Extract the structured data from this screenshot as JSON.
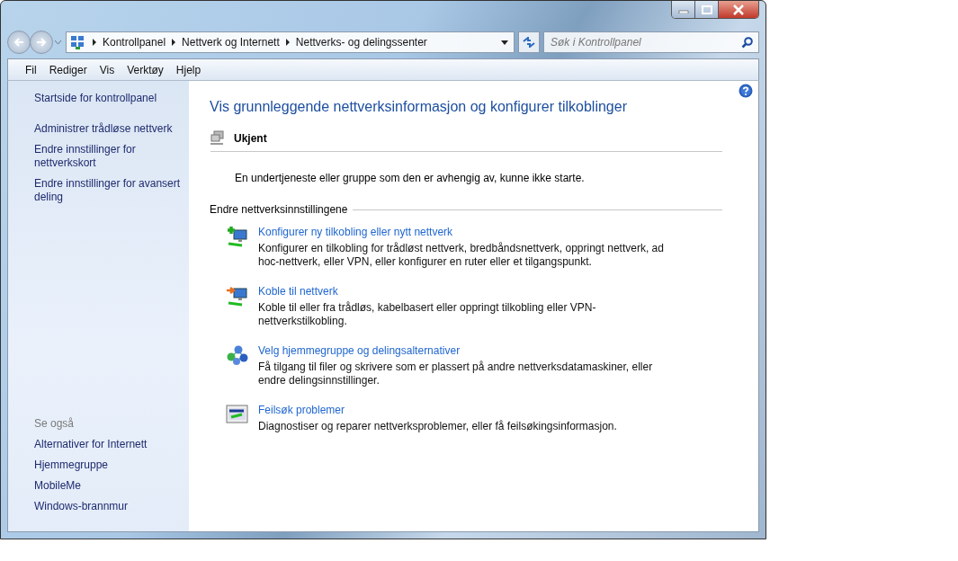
{
  "address_bar": {
    "breadcrumbs": [
      "Kontrollpanel",
      "Nettverk og Internett",
      "Nettverks- og delingssenter"
    ]
  },
  "search": {
    "placeholder": "Søk i Kontrollpanel"
  },
  "menu": [
    "Fil",
    "Rediger",
    "Vis",
    "Verktøy",
    "Hjelp"
  ],
  "sidebar": {
    "links": [
      "Startside for kontrollpanel",
      "Administrer trådløse nettverk",
      "Endre innstillinger for nettverkskort",
      "Endre innstillinger for avansert deling"
    ],
    "see_also_heading": "Se også",
    "see_also": [
      "Alternativer for Internett",
      "Hjemmegruppe",
      "MobileMe",
      "Windows-brannmur"
    ]
  },
  "main": {
    "title": "Vis grunnleggende nettverksinformasjon og konfigurer tilkoblinger",
    "network_name": "Ukjent",
    "status_message": "En undertjeneste eller gruppe som den er avhengig av, kunne ikke starte.",
    "section_heading": "Endre nettverksinnstillingene",
    "tasks": [
      {
        "title": "Konfigurer ny tilkobling eller nytt nettverk",
        "description": "Konfigurer en tilkobling for trådløst nettverk, bredbåndsnettverk, oppringt nettverk, ad hoc-nettverk, eller VPN, eller konfigurer en ruter eller et tilgangspunkt."
      },
      {
        "title": "Koble til nettverk",
        "description": "Koble til eller fra trådløs, kabelbasert eller oppringt tilkobling eller VPN-nettverkstilkobling."
      },
      {
        "title": "Velg hjemmegruppe og delingsalternativer",
        "description": "Få tilgang til filer og skrivere som er plassert på andre nettverksdatamaskiner, eller endre delingsinnstillinger."
      },
      {
        "title": "Feilsøk problemer",
        "description": "Diagnostiser og reparer nettverksproblemer, eller få feilsøkingsinformasjon."
      }
    ]
  }
}
